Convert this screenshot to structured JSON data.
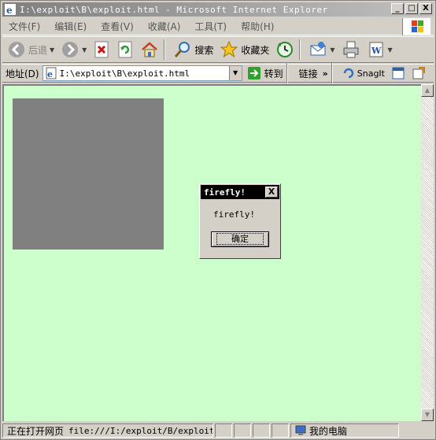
{
  "window": {
    "title": "I:\\exploit\\B\\exploit.html - Microsoft Internet Explorer",
    "minimize": "_",
    "maximize": "□",
    "close": "X"
  },
  "menu": {
    "items": [
      "文件(F)",
      "编辑(E)",
      "查看(V)",
      "收藏(A)",
      "工具(T)",
      "帮助(H)"
    ]
  },
  "toolbar": {
    "back_label": "后退",
    "search_label": "搜索",
    "favorites_label": "收藏夹"
  },
  "address": {
    "label": "地址(D)",
    "value": "I:\\exploit\\B\\exploit.html",
    "go_label": "转到",
    "links_label": "链接",
    "snagit_label": "SnagIt"
  },
  "page": {
    "background": "#ccffcc",
    "box_color": "#808080"
  },
  "dialog": {
    "title": "firefly!",
    "message": "firefly!",
    "ok_label": "确定",
    "close_glyph": "X"
  },
  "status": {
    "loading_text": "正在打开网页",
    "url_text": "file:///I:/exploit/B/exploit.html",
    "zone_text": "我的电脑"
  },
  "icons": {
    "back": "back-arrow-icon",
    "forward": "forward-arrow-icon",
    "stop": "stop-icon",
    "refresh": "refresh-icon",
    "home": "home-icon",
    "search": "search-icon",
    "favorites": "favorites-star-icon",
    "history": "history-icon",
    "mail": "mail-icon",
    "print": "print-icon",
    "edit": "edit-word-icon"
  }
}
